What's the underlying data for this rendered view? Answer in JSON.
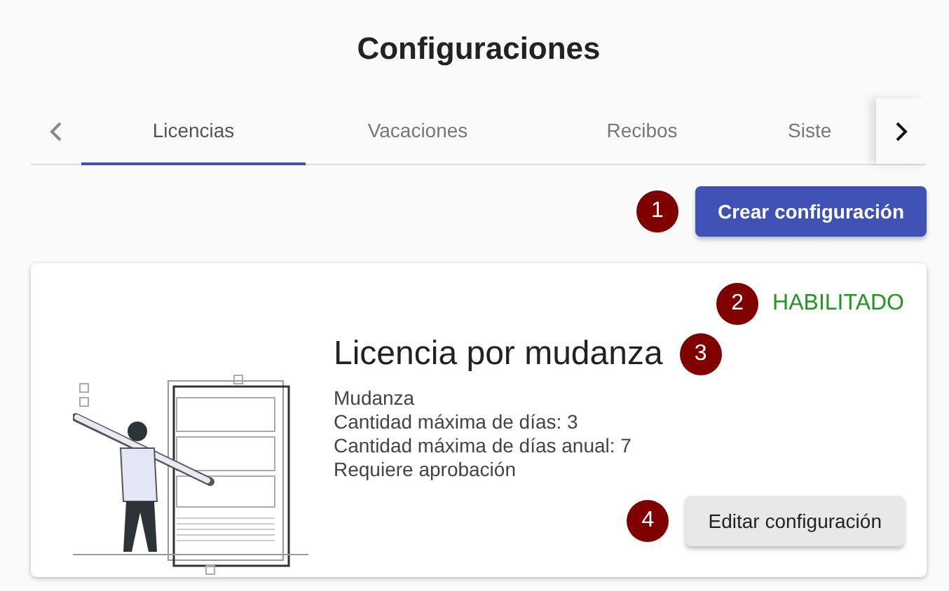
{
  "title": "Configuraciones",
  "tabs": [
    {
      "label": "Licencias",
      "selected": true
    },
    {
      "label": "Vacaciones",
      "selected": false
    },
    {
      "label": "Recibos",
      "selected": false
    },
    {
      "label": "Siste",
      "selected": false
    }
  ],
  "create_button": {
    "label": "Crear configuración",
    "marker": "1"
  },
  "card": {
    "status": {
      "label": "HABILITADO",
      "enabled": true,
      "marker": "2"
    },
    "title": "Licencia por mudanza",
    "title_marker": "3",
    "details": [
      "Mudanza",
      "Cantidad máxima de días: 3",
      "Cantidad máxima de días anual: 7",
      "Requiere aprobación"
    ],
    "edit_button": {
      "label": "Editar configuración",
      "marker": "4"
    }
  }
}
